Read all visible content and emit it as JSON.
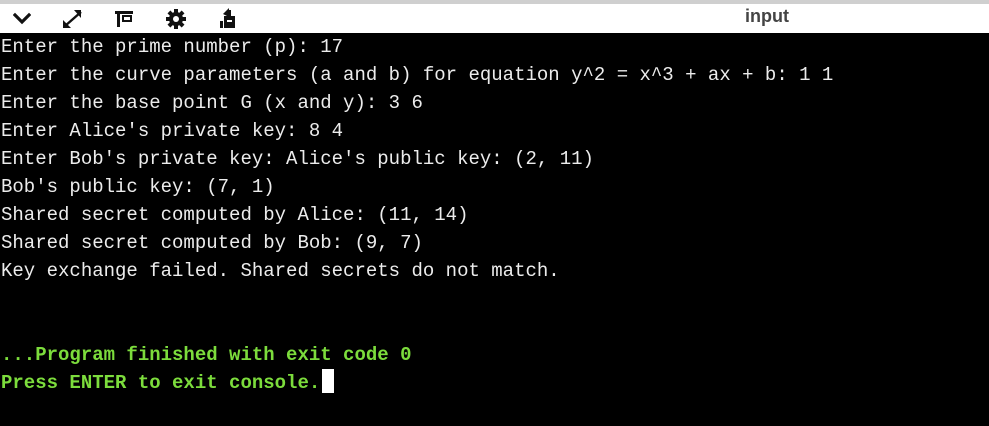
{
  "toolbar": {
    "icons": [
      "chevron-down-icon",
      "expand-icon",
      "layout-icon",
      "gear-icon",
      "share-icon"
    ],
    "input_label": "input"
  },
  "console": {
    "lines": [
      "Enter the prime number (p): 17",
      "Enter the curve parameters (a and b) for equation y^2 = x^3 + ax + b: 1 1",
      "Enter the base point G (x and y): 3 6",
      "Enter Alice's private key: 8 4",
      "Enter Bob's private key: Alice's public key: (2, 11)",
      "Bob's public key: (7, 1)",
      "Shared secret computed by Alice: (11, 14)",
      "Shared secret computed by Bob: (9, 7)",
      "Key exchange failed. Shared secrets do not match."
    ],
    "finished_message": "...Program finished with exit code 0",
    "exit_prompt": "Press ENTER to exit console."
  }
}
